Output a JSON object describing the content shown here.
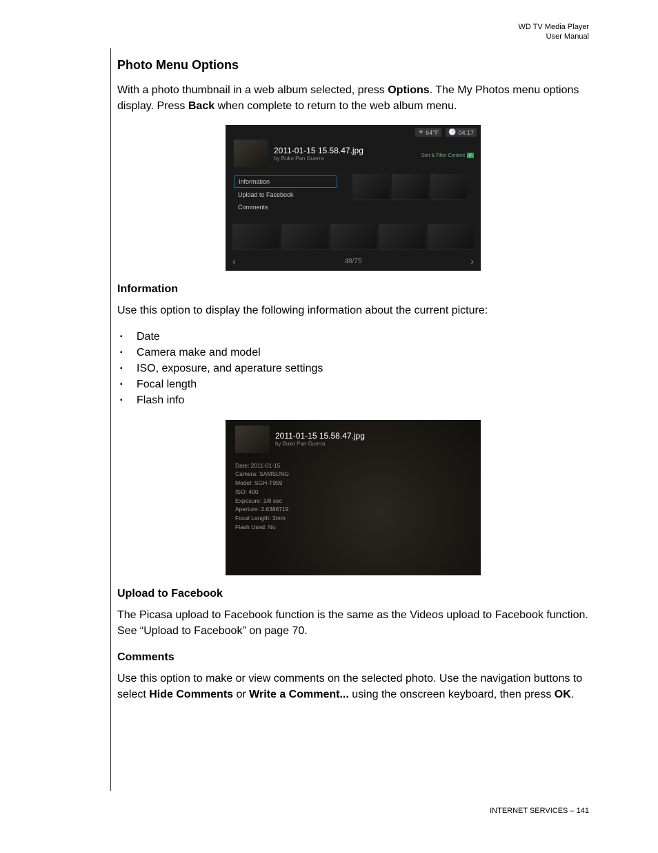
{
  "header": {
    "product": "WD TV Media Player",
    "doc_type": "User Manual"
  },
  "section": {
    "title": "Photo Menu Options",
    "intro_pre": "With a photo thumbnail in a web album selected, press ",
    "intro_bold1": "Options",
    "intro_mid": ". The My Photos menu options display. Press ",
    "intro_bold2": "Back",
    "intro_post": " when complete to return to the web album menu."
  },
  "shot1": {
    "temp": "64°F",
    "time": "04:17",
    "filename": "2011-01-15 15.58.47.jpg",
    "byline": "by Buko Pan Guerra",
    "filter": "Sort & Filter Content",
    "menu": [
      "Information",
      "Upload to Facebook",
      "Comments"
    ],
    "pager": "48/75"
  },
  "info_section": {
    "title": "Information",
    "lead": "Use this option to display the following information about the current picture:",
    "bullets": [
      "Date",
      "Camera make and model",
      "ISO, exposure, and aperature settings",
      "Focal length",
      "Flash info"
    ]
  },
  "shot2": {
    "filename": "2011-01-15 15.58.47.jpg",
    "byline": "by Buko Pan Guerra",
    "info": [
      "Date: 2011-01-15",
      "Camera: SAMSUNG",
      "Model: SGH-T959",
      "ISO: 400",
      "Exposure: 1/8 sec",
      "Aperture: 2.6386719",
      "Focal Length: 3mm",
      "Flash Used: No"
    ]
  },
  "upload": {
    "title": "Upload to Facebook",
    "body": "The Picasa upload to Facebook function is the same as the Videos upload to Facebook function. See “Upload to Facebook” on page 70."
  },
  "comments": {
    "title": "Comments",
    "p1_pre": "Use this option to make or view comments on the selected photo. Use the navigation buttons to select ",
    "p1_b1": "Hide Comments",
    "p1_mid1": " or ",
    "p1_b2": "Write a Comment...",
    "p1_mid2": " using the onscreen keyboard, then press ",
    "p1_b3": "OK",
    "p1_post": "."
  },
  "footer": {
    "section_name": "INTERNET SERVICES",
    "page_num": "141"
  }
}
